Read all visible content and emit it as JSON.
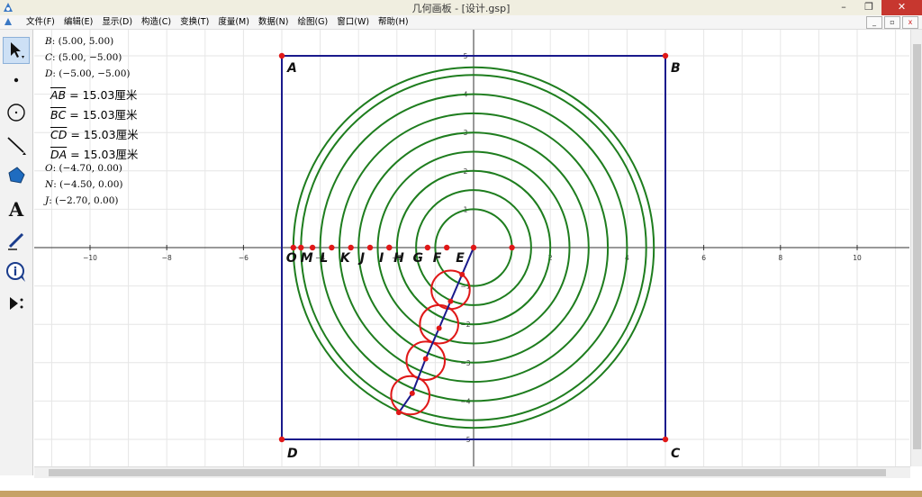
{
  "window": {
    "title": "几何画板 - [设计.gsp]",
    "min_label": "–",
    "max_label": "❐",
    "close_label": "✕"
  },
  "menu": [
    {
      "label": "文件(F)"
    },
    {
      "label": "编辑(E)"
    },
    {
      "label": "显示(D)"
    },
    {
      "label": "构造(C)"
    },
    {
      "label": "变换(T)"
    },
    {
      "label": "度量(M)"
    },
    {
      "label": "数据(N)"
    },
    {
      "label": "绘图(G)"
    },
    {
      "label": "窗口(W)"
    },
    {
      "label": "帮助(H)"
    }
  ],
  "mdi": {
    "min": "_",
    "restore": "▫",
    "close": "x"
  },
  "tools": [
    {
      "name": "arrow-select-tool",
      "active": true
    },
    {
      "name": "point-tool"
    },
    {
      "name": "compass-tool"
    },
    {
      "name": "straightedge-tool"
    },
    {
      "name": "polygon-tool"
    },
    {
      "name": "text-tool",
      "glyph": "A"
    },
    {
      "name": "marker-tool"
    },
    {
      "name": "information-tool"
    },
    {
      "name": "custom-tool"
    }
  ],
  "measurements": [
    {
      "id": "B",
      "label": "B",
      "value": ": (5.00, 5.00)"
    },
    {
      "id": "C",
      "label": "C",
      "value": ": (5.00, −5.00)"
    },
    {
      "id": "D",
      "label": "D",
      "value": ": (−5.00, −5.00)"
    },
    {
      "id": "AB",
      "seg": "AB",
      "value": " = 15.03厘米"
    },
    {
      "id": "BC",
      "seg": "BC",
      "value": " = 15.03厘米"
    },
    {
      "id": "CD",
      "seg": "CD",
      "value": " = 15.03厘米"
    },
    {
      "id": "DA",
      "seg": "DA",
      "value": " = 15.03厘米"
    },
    {
      "id": "O",
      "label": "O",
      "value": ": (−4.70, 0.00)"
    },
    {
      "id": "N",
      "label": "N",
      "value": ": (−4.50, 0.00)"
    },
    {
      "id": "J",
      "label": "J",
      "value": ": (−2.70, 0.00)"
    }
  ],
  "colors": {
    "axis": "#333333",
    "grid": "#e6e6e6",
    "square": "#1a1a8c",
    "circles": "#1e7d1e",
    "small_circles": "#e01818",
    "points": "#e01818",
    "chain": "#1a1a8c"
  },
  "axes": {
    "x_ticks": [
      -10,
      -8,
      -6,
      -4,
      -2,
      2,
      4,
      6,
      8,
      10
    ],
    "y_ticks": [
      -5,
      -4,
      -3,
      -2,
      -1,
      1,
      2,
      3,
      4,
      5
    ],
    "x_range": [
      -11,
      11.5
    ],
    "y_range": [
      -5.5,
      5.8
    ]
  },
  "square": {
    "A": [
      -5,
      5
    ],
    "B": [
      5,
      5
    ],
    "C": [
      5,
      -5
    ],
    "D": [
      -5,
      -5
    ]
  },
  "circle_radii": [
    1,
    1.5,
    2,
    2.5,
    3,
    3.5,
    4,
    4.5,
    4.7
  ],
  "axis_points": [
    {
      "name": "E",
      "x": 0
    },
    {
      "name": "F",
      "x": -0.7
    },
    {
      "name": "G",
      "x": -1.2
    },
    {
      "name": "H",
      "x": -2.2
    },
    {
      "name": "I",
      "x": -2.2
    },
    {
      "name": "J",
      "x": -2.7
    },
    {
      "name": "K",
      "x": -3.2
    },
    {
      "name": "L",
      "x": -3.7
    },
    {
      "name": "M",
      "x": -4.2
    },
    {
      "name": "N",
      "x": -4.5
    },
    {
      "name": "O",
      "x": -4.7
    },
    {
      "name": "",
      "x": 1
    }
  ],
  "axis_labels": [
    {
      "text": "E",
      "x": -0.35
    },
    {
      "text": "F",
      "x": -0.95
    },
    {
      "text": "G",
      "x": -1.45
    },
    {
      "text": "H",
      "x": -1.95
    },
    {
      "text": "I",
      "x": -2.4
    },
    {
      "text": "J",
      "x": -2.9
    },
    {
      "text": "K",
      "x": -3.35
    },
    {
      "text": "L",
      "x": -3.9
    },
    {
      "text": "M",
      "x": -4.35
    },
    {
      "text": "O",
      "x": -4.75
    }
  ],
  "chain_points": [
    [
      0,
      0
    ],
    [
      -0.3,
      -0.7
    ],
    [
      -0.6,
      -1.4
    ],
    [
      -0.9,
      -2.1
    ],
    [
      -1.25,
      -2.9
    ],
    [
      -1.6,
      -3.8
    ],
    [
      -1.95,
      -4.3
    ]
  ],
  "red_circles": [
    {
      "c": [
        -0.6,
        -1.1
      ],
      "r": 0.5
    },
    {
      "c": [
        -0.9,
        -2.0
      ],
      "r": 0.5
    },
    {
      "c": [
        -1.25,
        -2.95
      ],
      "r": 0.5
    },
    {
      "c": [
        -1.65,
        -3.85
      ],
      "r": 0.5
    }
  ]
}
